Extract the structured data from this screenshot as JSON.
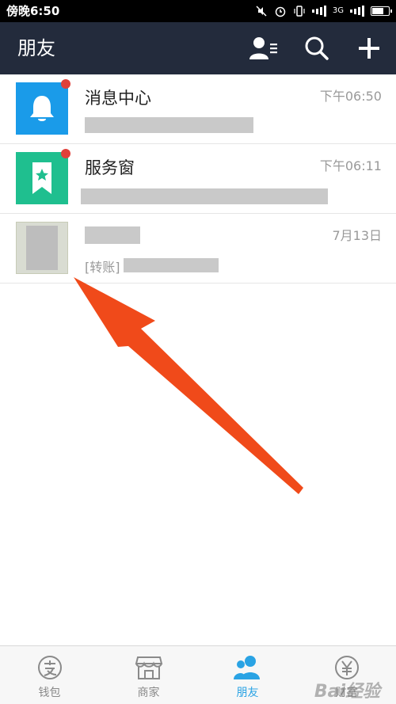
{
  "status_bar": {
    "time": "傍晚6:50",
    "network": "3G"
  },
  "header": {
    "title": "朋友",
    "actions": [
      "contacts-icon",
      "search-icon",
      "plus-icon"
    ]
  },
  "messages": [
    {
      "title": "消息中心",
      "time": "下午06:50",
      "icon": "bell-icon",
      "unread": true
    },
    {
      "title": "服务窗",
      "time": "下午06:11",
      "icon": "bookmark-star-icon",
      "unread": true
    },
    {
      "title": "",
      "time": "7月13日",
      "preview_prefix": "[转账]",
      "icon": "contact-avatar",
      "unread": false
    }
  ],
  "tabs": [
    {
      "label": "钱包",
      "icon": "wallet-icon",
      "active": false
    },
    {
      "label": "商家",
      "icon": "store-icon",
      "active": false
    },
    {
      "label": "朋友",
      "icon": "friends-icon",
      "active": true
    },
    {
      "label": "财富",
      "icon": "wealth-icon",
      "active": false
    }
  ],
  "colors": {
    "header_bg": "#232b3c",
    "accent": "#2aa3e4",
    "unread_dot": "#e0403a",
    "message_center_icon": "#1a9be9",
    "service_window_icon": "#1fbf8f",
    "annotation_arrow": "#f04a1a"
  },
  "watermark": "Bai经验"
}
